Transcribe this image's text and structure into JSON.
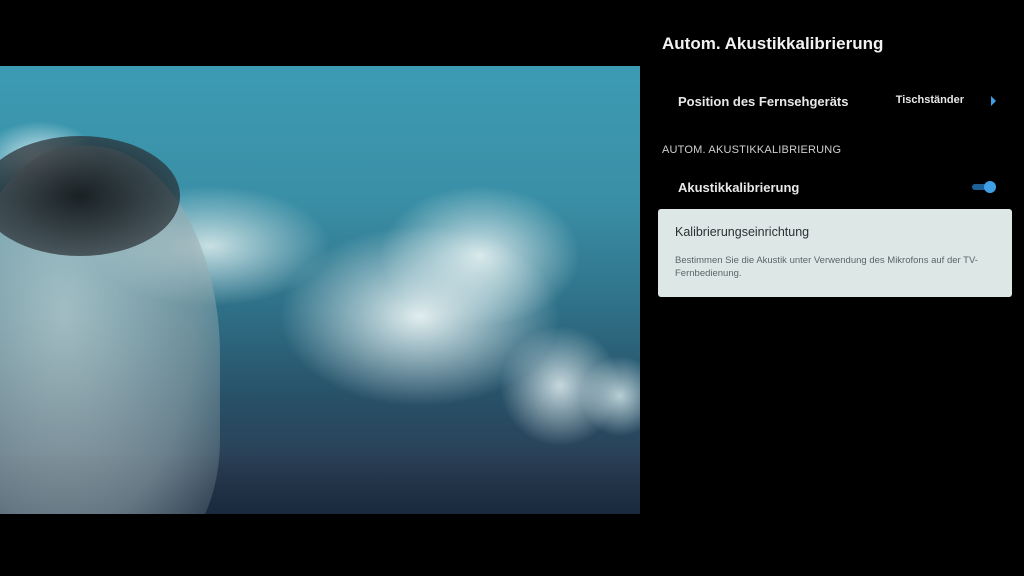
{
  "panel": {
    "title": "Autom. Akustikkalibrierung",
    "tv_position": {
      "label": "Position des Fernsehgeräts",
      "value": "Tischständer",
      "icon": "chevron-right-icon"
    },
    "section_header": "AUTOM. AKUSTIKKALIBRIERUNG",
    "calibration_toggle": {
      "label": "Akustikkalibrierung",
      "state": "on"
    },
    "setup_card": {
      "title": "Kalibrierungseinrichtung",
      "description": "Bestimmen Sie die Akustik unter Verwendung des Mikrofons auf der TV-Fernbedienung."
    }
  },
  "colors": {
    "accent": "#3fa0e6",
    "background": "#000000",
    "card_background": "#dde8e6"
  }
}
